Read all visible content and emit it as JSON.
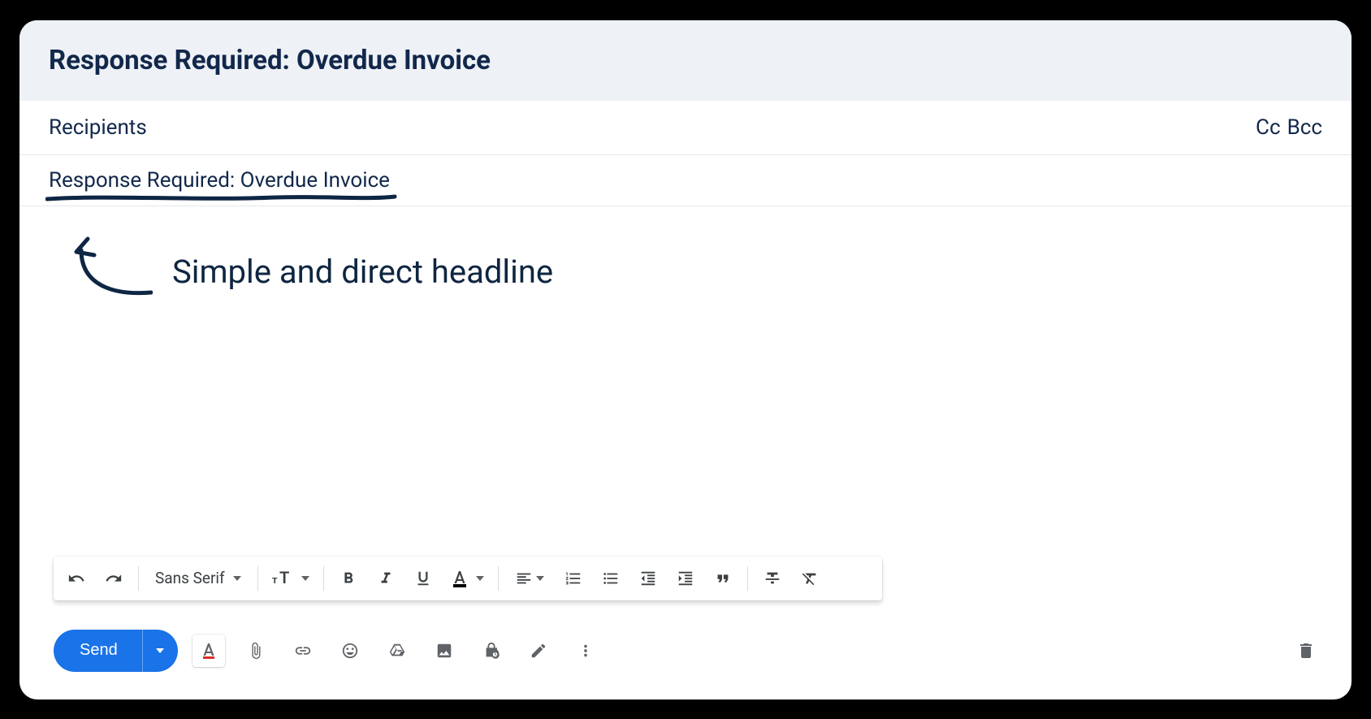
{
  "header": {
    "title": "Response Required: Overdue Invoice"
  },
  "recipients": {
    "label": "Recipients",
    "cc_label": "Cc",
    "bcc_label": "Bcc"
  },
  "subject": {
    "value": "Response Required: Overdue Invoice"
  },
  "annotation": {
    "text": "Simple and direct headline"
  },
  "format_toolbar": {
    "font_name": "Sans Serif"
  },
  "actions": {
    "send_label": "Send"
  }
}
